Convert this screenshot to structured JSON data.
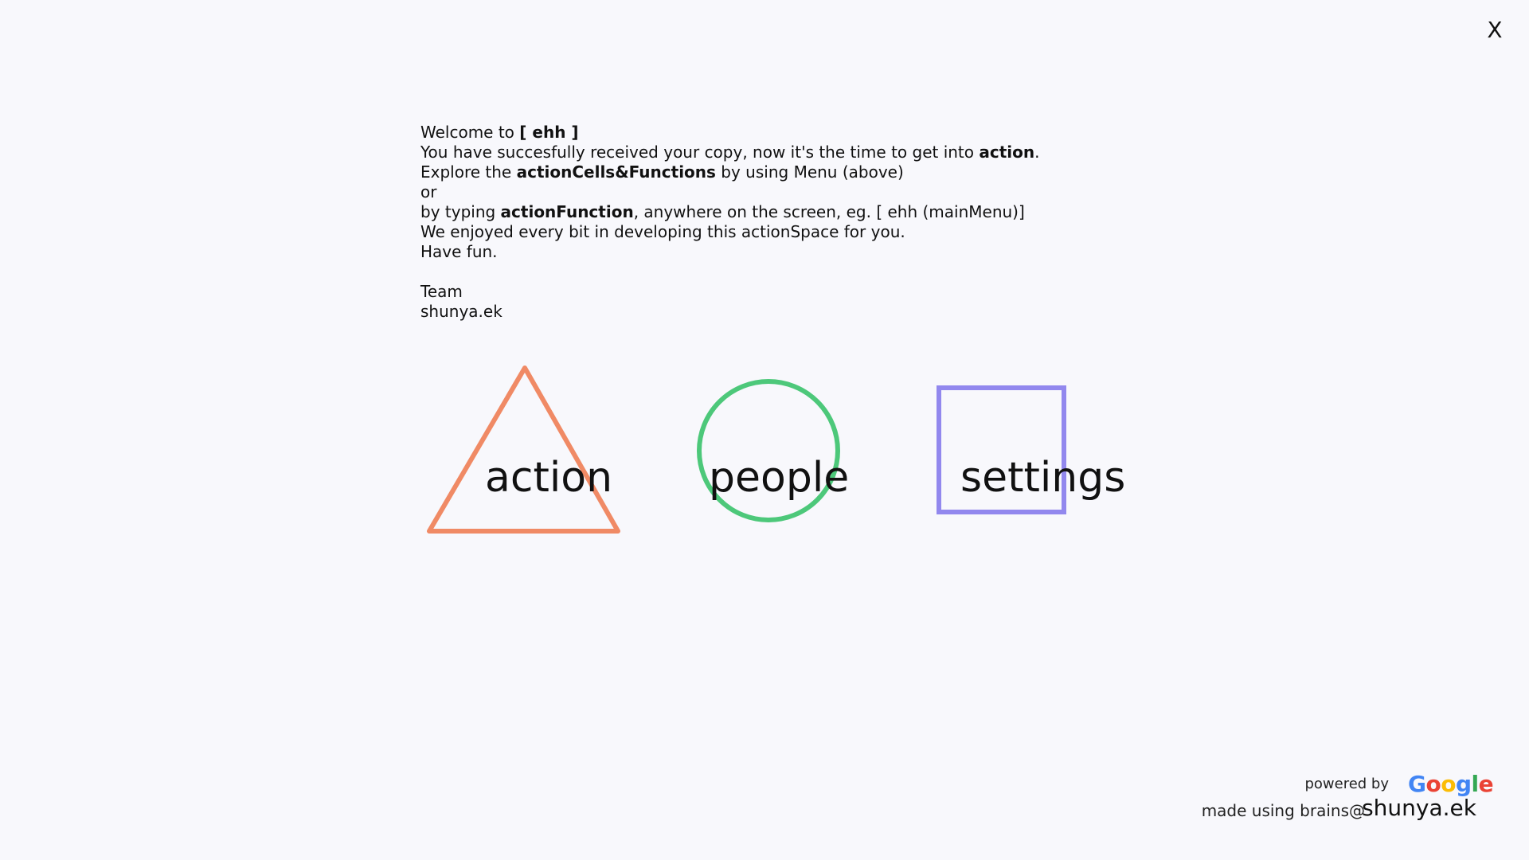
{
  "close_button": {
    "label": "X"
  },
  "welcome": {
    "line1": {
      "prefix": "Welcome to ",
      "bold": "[ ehh ]"
    },
    "line2": {
      "prefix": "You have succesfully received your copy, now it's the time to get into ",
      "bold": "action",
      "suffix": "."
    },
    "line3": {
      "prefix": "Explore the ",
      "bold": "actionCells&Functions",
      "suffix": " by using Menu (above)"
    },
    "line4": "or",
    "line5": {
      "prefix": "by typing ",
      "bold": "actionFunction",
      "suffix": ", anywhere on the screen, eg. [ ehh (mainMenu)]"
    },
    "line6": "We enjoyed every bit in developing this actionSpace for you.",
    "line7": "Have fun.",
    "signature1": "Team",
    "signature2": "shunya.ek"
  },
  "shortcuts": [
    {
      "label": "action",
      "shape": "triangle-icon",
      "color": "#f08a65"
    },
    {
      "label": "people",
      "shape": "circle-icon",
      "color": "#4dc87a"
    },
    {
      "label": "settings",
      "shape": "square-icon",
      "color": "#9288ee"
    }
  ],
  "footer": {
    "powered_by": "powered by",
    "google_letters": [
      {
        "ch": "G",
        "color": "#4285F4"
      },
      {
        "ch": "o",
        "color": "#EA4335"
      },
      {
        "ch": "o",
        "color": "#FBBC05"
      },
      {
        "ch": "g",
        "color": "#4285F4"
      },
      {
        "ch": "l",
        "color": "#34A853"
      },
      {
        "ch": "e",
        "color": "#EA4335"
      }
    ],
    "made_using": "made using brains@",
    "brand": "shunya.ek"
  }
}
